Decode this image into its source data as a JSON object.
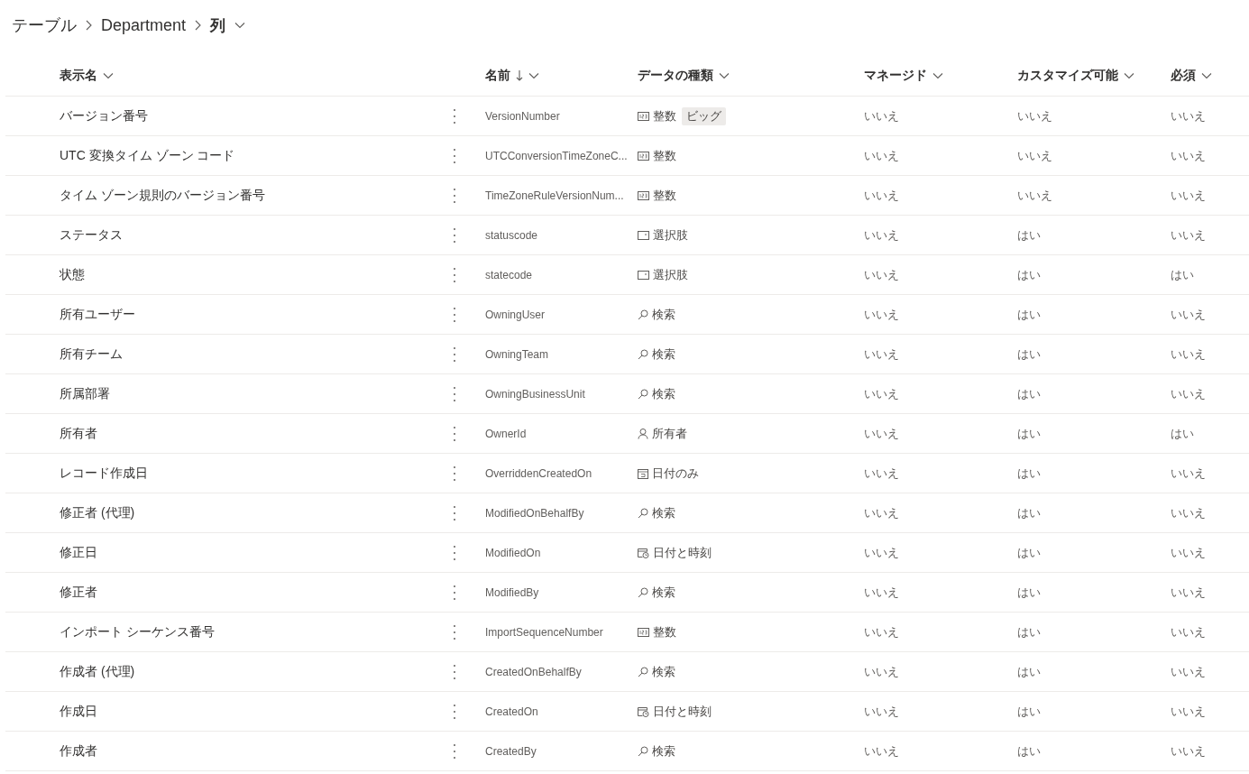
{
  "breadcrumb": [
    {
      "label": "テーブル",
      "current": false
    },
    {
      "label": "Department",
      "current": false
    },
    {
      "label": "列",
      "current": true
    }
  ],
  "table": {
    "columns": [
      {
        "label": "表示名",
        "sorted_descending": false
      },
      {
        "label": "名前",
        "sorted_descending": true
      },
      {
        "label": "データの種類",
        "sorted_descending": false
      },
      {
        "label": "マネージド",
        "sorted_descending": false
      },
      {
        "label": "カスタマイズ可能",
        "sorted_descending": false
      },
      {
        "label": "必須",
        "sorted_descending": false
      }
    ],
    "rows": [
      {
        "display_name": "バージョン番号",
        "name": "VersionNumber",
        "kind": "integer",
        "type": "整数",
        "badge": "ビッグ",
        "managed": "いいえ",
        "customizable": "いいえ",
        "required": "いいえ"
      },
      {
        "display_name": "UTC 変換タイム ゾーン コード",
        "name": "UTCConversionTimeZoneC...",
        "kind": "integer",
        "type": "整数",
        "managed": "いいえ",
        "customizable": "いいえ",
        "required": "いいえ"
      },
      {
        "display_name": "タイム ゾーン規則のバージョン番号",
        "name": "TimeZoneRuleVersionNum...",
        "kind": "integer",
        "type": "整数",
        "managed": "いいえ",
        "customizable": "いいえ",
        "required": "いいえ"
      },
      {
        "display_name": "ステータス",
        "name": "statuscode",
        "kind": "choice",
        "type": "選択肢",
        "managed": "いいえ",
        "customizable": "はい",
        "required": "いいえ"
      },
      {
        "display_name": "状態",
        "name": "statecode",
        "kind": "choice",
        "type": "選択肢",
        "managed": "いいえ",
        "customizable": "はい",
        "required": "はい"
      },
      {
        "display_name": "所有ユーザー",
        "name": "OwningUser",
        "kind": "lookup",
        "type": "検索",
        "managed": "いいえ",
        "customizable": "はい",
        "required": "いいえ"
      },
      {
        "display_name": "所有チーム",
        "name": "OwningTeam",
        "kind": "lookup",
        "type": "検索",
        "managed": "いいえ",
        "customizable": "はい",
        "required": "いいえ"
      },
      {
        "display_name": "所属部署",
        "name": "OwningBusinessUnit",
        "kind": "lookup",
        "type": "検索",
        "managed": "いいえ",
        "customizable": "はい",
        "required": "いいえ"
      },
      {
        "display_name": "所有者",
        "name": "OwnerId",
        "kind": "owner",
        "type": "所有者",
        "managed": "いいえ",
        "customizable": "はい",
        "required": "はい"
      },
      {
        "display_name": "レコード作成日",
        "name": "OverriddenCreatedOn",
        "kind": "date",
        "type": "日付のみ",
        "managed": "いいえ",
        "customizable": "はい",
        "required": "いいえ"
      },
      {
        "display_name": "修正者 (代理)",
        "name": "ModifiedOnBehalfBy",
        "kind": "lookup",
        "type": "検索",
        "managed": "いいえ",
        "customizable": "はい",
        "required": "いいえ"
      },
      {
        "display_name": "修正日",
        "name": "ModifiedOn",
        "kind": "datetime",
        "type": "日付と時刻",
        "managed": "いいえ",
        "customizable": "はい",
        "required": "いいえ"
      },
      {
        "display_name": "修正者",
        "name": "ModifiedBy",
        "kind": "lookup",
        "type": "検索",
        "managed": "いいえ",
        "customizable": "はい",
        "required": "いいえ"
      },
      {
        "display_name": "インポート シーケンス番号",
        "name": "ImportSequenceNumber",
        "kind": "integer",
        "type": "整数",
        "managed": "いいえ",
        "customizable": "はい",
        "required": "いいえ"
      },
      {
        "display_name": "作成者 (代理)",
        "name": "CreatedOnBehalfBy",
        "kind": "lookup",
        "type": "検索",
        "managed": "いいえ",
        "customizable": "はい",
        "required": "いいえ"
      },
      {
        "display_name": "作成日",
        "name": "CreatedOn",
        "kind": "datetime",
        "type": "日付と時刻",
        "managed": "いいえ",
        "customizable": "はい",
        "required": "いいえ"
      },
      {
        "display_name": "作成者",
        "name": "CreatedBy",
        "kind": "lookup",
        "type": "検索",
        "managed": "いいえ",
        "customizable": "はい",
        "required": "いいえ"
      }
    ]
  }
}
